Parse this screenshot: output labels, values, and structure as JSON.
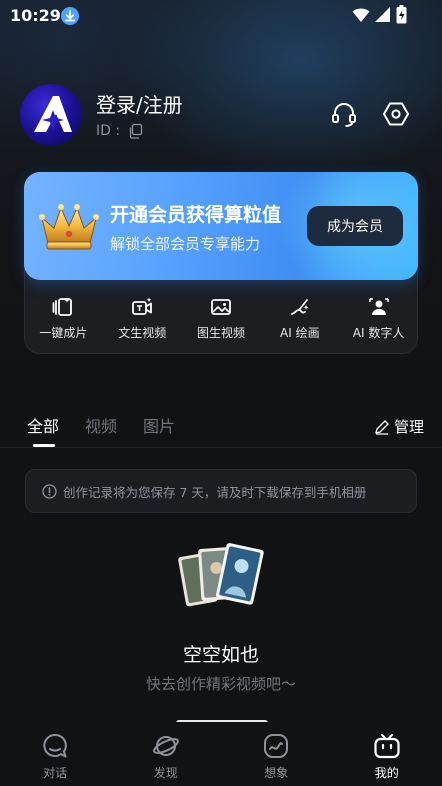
{
  "status_bar": {
    "time": "10:29"
  },
  "profile": {
    "login_label": "登录/注册",
    "id_label": "ID :"
  },
  "vip": {
    "title": "开通会员获得算粒值",
    "subtitle": "解锁全部会员专享能力",
    "button": "成为会员"
  },
  "tools": [
    {
      "label": "一键成片",
      "icon": "one-click-film-icon"
    },
    {
      "label": "文生视频",
      "icon": "text-to-video-icon"
    },
    {
      "label": "图生视频",
      "icon": "image-to-video-icon"
    },
    {
      "label": "AI 绘画",
      "icon": "ai-painting-icon"
    },
    {
      "label": "AI 数字人",
      "icon": "ai-digital-human-icon"
    }
  ],
  "tabs": [
    {
      "label": "全部",
      "active": true
    },
    {
      "label": "视频",
      "active": false
    },
    {
      "label": "图片",
      "active": false
    }
  ],
  "manage_label": "管理",
  "notice": "创作记录将为您保存 7 天，请及时下载保存到手机相册",
  "empty": {
    "title": "空空如也",
    "subtitle": "快去创作精彩视频吧～"
  },
  "bottom_nav": [
    {
      "label": "对话",
      "icon": "chat-icon",
      "active": false
    },
    {
      "label": "发现",
      "icon": "planet-icon",
      "active": false
    },
    {
      "label": "想象",
      "icon": "imagine-icon",
      "active": false
    },
    {
      "label": "我的",
      "icon": "tv-face-icon",
      "active": true
    }
  ],
  "colors": {
    "background": "#111214",
    "accent_blue": "#5aa3ff",
    "muted_text": "#8e939b"
  }
}
